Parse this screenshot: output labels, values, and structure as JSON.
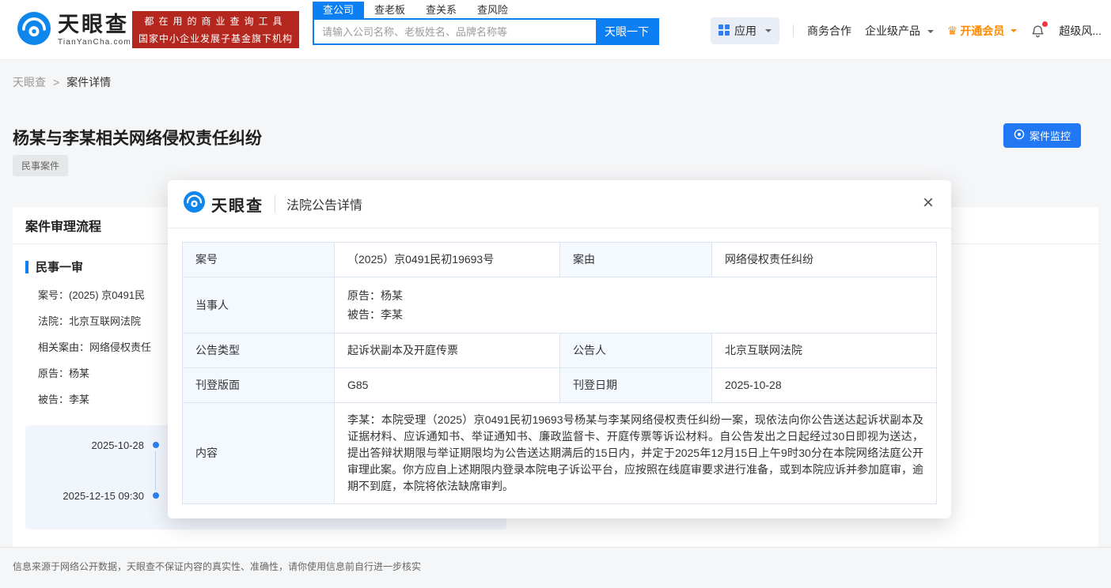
{
  "colors": {
    "brand_blue": "#0c80f2",
    "slogan_red": "#b4271e",
    "vip_orange": "#ff8a00",
    "table_label_bg": "#f3f9ff"
  },
  "icons": {
    "crown": "♛",
    "close": "×"
  },
  "brand": {
    "name": "天眼查",
    "domain": "TianYanCha.com",
    "slogan_line1": "都在用的商业查询工具",
    "slogan_line2": "国家中小企业发展子基金旗下机构"
  },
  "header": {
    "search": {
      "tabs": [
        {
          "label": "查公司",
          "active": true
        },
        {
          "label": "查老板",
          "active": false
        },
        {
          "label": "查关系",
          "active": false
        },
        {
          "label": "查风险",
          "active": false
        }
      ],
      "placeholder": "请输入公司名称、老板姓名、品牌名称等",
      "button": "天眼一下"
    },
    "nav": {
      "apps": "应用",
      "cooperation": "商务合作",
      "enterprise": "企业级产品",
      "vip": "开通会员",
      "super_risk": "超级风..."
    }
  },
  "breadcrumb": {
    "home": "天眼查",
    "separator": ">",
    "current": "案件详情"
  },
  "page": {
    "title": "杨某与李某相关网络侵权责任纠纷",
    "case_type_tag": "民事案件",
    "monitor_button": "案件监控"
  },
  "case_flow": {
    "section_title": "案件审理流程",
    "stage_title": "民事一审",
    "fields": [
      {
        "label": "案号：",
        "value": "(2025) 京0491民"
      },
      {
        "label": "法院：",
        "value": "北京互联网法院"
      },
      {
        "label": "相关案由：",
        "value": "网络侵权责任"
      },
      {
        "label": "原告：",
        "value": "杨某"
      },
      {
        "label": "被告：",
        "value": "李某"
      }
    ],
    "timeline": [
      {
        "date": "2025-10-28"
      },
      {
        "date": "2025-12-15 09:30"
      }
    ]
  },
  "modal": {
    "brand": "天眼查",
    "title": "法院公告详情",
    "table": {
      "row_case": {
        "label1": "案号",
        "value1": "（2025）京0491民初19693号",
        "label2": "案由",
        "value2": "网络侵权责任纠纷"
      },
      "row_party": {
        "label": "当事人",
        "plaintiff": "原告：杨某",
        "defendant": "被告：李某"
      },
      "row_notice": {
        "label1": "公告类型",
        "value1": "起诉状副本及开庭传票",
        "label2": "公告人",
        "value2": "北京互联网法院"
      },
      "row_publish": {
        "label1": "刊登版面",
        "value1": "G85",
        "label2": "刊登日期",
        "value2": "2025-10-28"
      },
      "row_content": {
        "label": "内容",
        "text": "李某：本院受理（2025）京0491民初19693号杨某与李某网络侵权责任纠纷一案，现依法向你公告送达起诉状副本及证据材料、应诉通知书、举证通知书、廉政监督卡、开庭传票等诉讼材料。自公告发出之日起经过30日即视为送达，提出答辩状期限与举证期限均为公告送达期满后的15日内，并定于2025年12月15日上午9时30分在本院网络法庭公开审理此案。你方应自上述期限内登录本院电子诉讼平台，应按照在线庭审要求进行准备，或到本院应诉并参加庭审，逾期不到庭，本院将依法缺席审判。"
      }
    }
  },
  "footer": {
    "disclaimer": "信息来源于网络公开数据，天眼查不保证内容的真实性、准确性，请你使用信息前自行进一步核实"
  }
}
